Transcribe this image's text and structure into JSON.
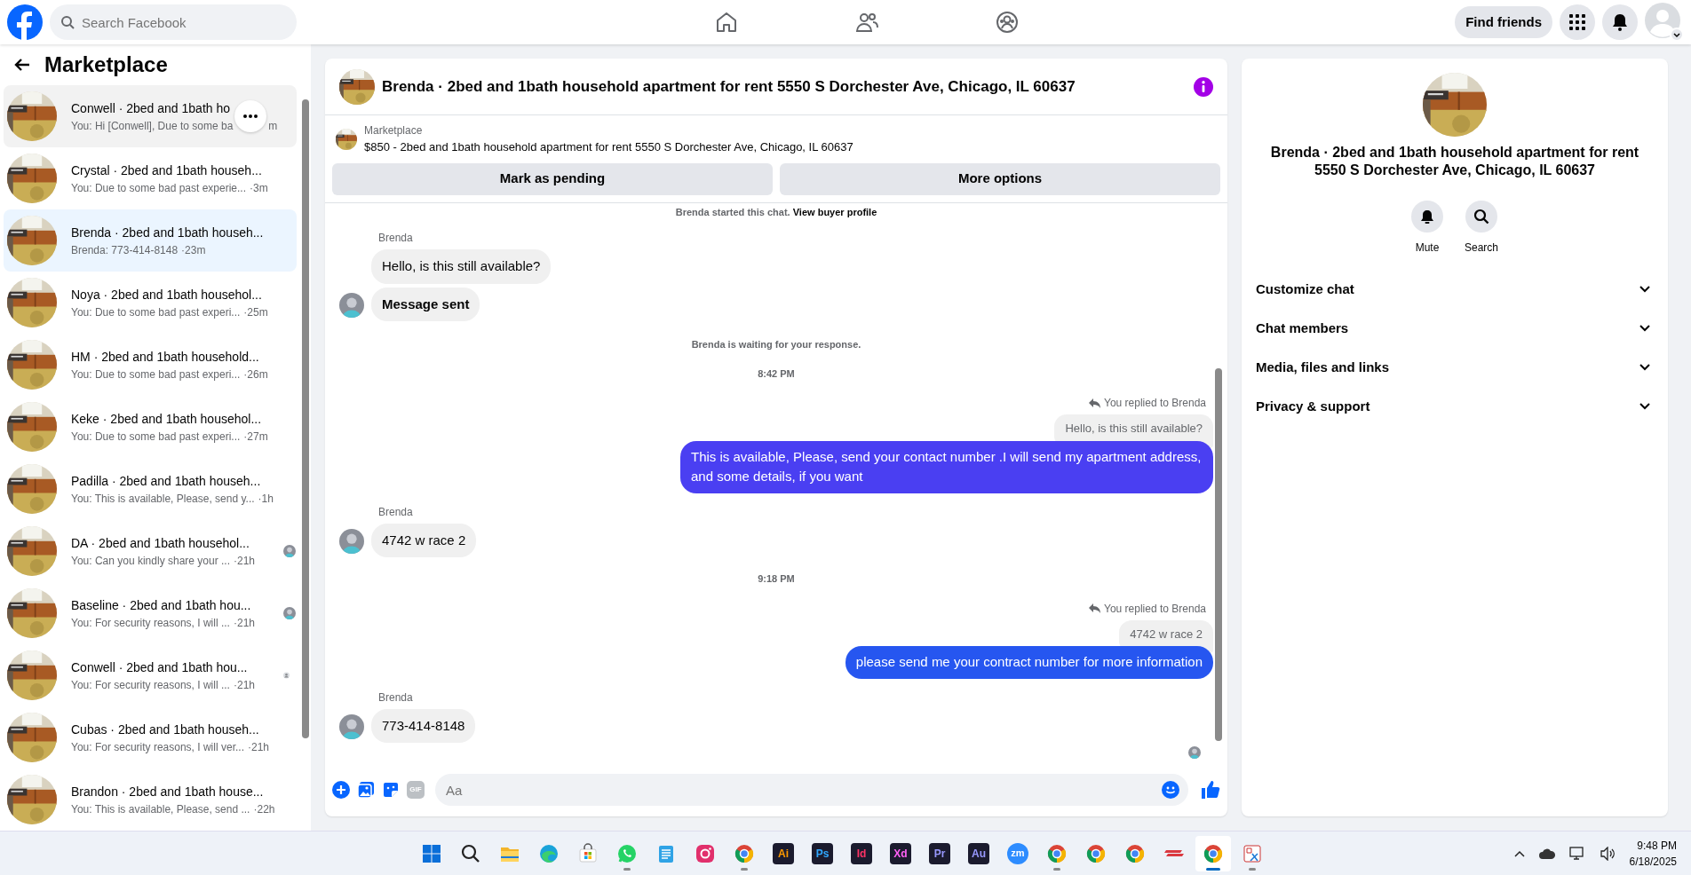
{
  "topbar": {
    "search": {
      "placeholder": "Search Facebook"
    },
    "nav": [
      {
        "kind": "home",
        "selected": false
      },
      {
        "kind": "friends",
        "selected": false
      },
      {
        "kind": "groups",
        "selected": false
      }
    ],
    "find_friends": "Find friends"
  },
  "sidebar": {
    "title": "Marketplace",
    "conversations": [
      {
        "title": "Conwell · 2bed and 1bath ho",
        "preview": "You: Hi [Conwell], Due to some ba",
        "time": "m",
        "selected": false,
        "hovered": true
      },
      {
        "title": "Crystal · 2bed and 1bath househ...",
        "preview": "You: Due to some bad past experie...",
        "time": "·3m",
        "selected": false,
        "hovered": false
      },
      {
        "title": "Brenda · 2bed and 1bath househ...",
        "preview": "Brenda: 773-414-8148",
        "time": "·23m",
        "selected": true,
        "hovered": false
      },
      {
        "title": "Noya · 2bed and 1bath househol...",
        "preview": "You: Due to some bad past experi...",
        "time": "·25m",
        "selected": false,
        "hovered": false
      },
      {
        "title": "HM · 2bed and 1bath household...",
        "preview": "You: Due to some bad past experi...",
        "time": "·26m",
        "selected": false,
        "hovered": false
      },
      {
        "title": "Keke · 2bed and 1bath househol...",
        "preview": "You: Due to some bad past experi...",
        "time": "·27m",
        "selected": false,
        "hovered": false
      },
      {
        "title": "Padilla · 2bed and 1bath househ...",
        "preview": "You: This is available, Please, send y...",
        "time": "·1h",
        "selected": false,
        "hovered": false
      },
      {
        "title": "DA · 2bed and 1bath househol...",
        "preview": "You: Can you kindly share your ...",
        "time": "·21h",
        "selected": false,
        "hovered": false
      },
      {
        "title": "Baseline · 2bed and 1bath hou...",
        "preview": "You: For security reasons, I will ...",
        "time": "·21h",
        "selected": false,
        "hovered": false
      },
      {
        "title": "Conwell · 2bed and 1bath hou...",
        "preview": "You: For security reasons, I will ...",
        "time": "·21h",
        "selected": false,
        "hovered": false,
        "receipt": {
          "kind": "silhouette"
        }
      },
      {
        "title": "Cubas · 2bed and 1bath househ...",
        "preview": "You: For security reasons, I will ver...",
        "time": "·21h",
        "selected": false,
        "hovered": false
      },
      {
        "title": "Brandon · 2bed and 1bath house...",
        "preview": "You: This is available, Please, send ...",
        "time": "·22h",
        "selected": false,
        "hovered": false
      }
    ]
  },
  "chat": {
    "title": "Brenda · 2bed and 1bath household apartment for rent 5550 S Dorchester Ave, Chicago, IL 60637",
    "listing": {
      "label": "Marketplace",
      "text": "$850 - 2bed and 1bath household apartment for rent 5550 S Dorchester Ave, Chicago, IL 60637",
      "buttons": [
        "Mark as pending",
        "More options"
      ]
    },
    "messages": [
      {
        "kind": "system",
        "text": "Brenda started this chat.",
        "link": "View buyer profile"
      },
      {
        "kind": "incoming",
        "sender": "Brenda",
        "bubbles": [
          {
            "text": "Hello, is this still available?",
            "bold": false
          },
          {
            "text": "Message sent",
            "bold": true
          }
        ]
      },
      {
        "kind": "status",
        "text": "Brenda is waiting for your response."
      },
      {
        "kind": "time",
        "text": "8:42 PM"
      },
      {
        "kind": "outgoing",
        "reply_note": "You replied to Brenda",
        "quoted": "Hello, is this still available?",
        "text": "This is  available, Please, send your contact number .I will send my apartment address, and some details, if you want",
        "color": "#4a3ff2"
      },
      {
        "kind": "incoming",
        "sender": "Brenda",
        "bubbles": [
          {
            "text": "4742 w race 2",
            "bold": false
          }
        ]
      },
      {
        "kind": "time",
        "text": "9:18 PM"
      },
      {
        "kind": "outgoing",
        "reply_note": "You replied to Brenda",
        "quoted": "4742 w race 2",
        "text": "please send me your contract number for more information",
        "color": "#2656f0"
      },
      {
        "kind": "incoming",
        "sender": "Brenda",
        "bubbles": [
          {
            "text": "773-414-8148",
            "bold": false
          }
        ]
      }
    ],
    "composer": {
      "gif": "GIF",
      "placeholder": "Aa"
    }
  },
  "details": {
    "title": "Brenda · 2bed and 1bath household apartment for rent 5550 S Dorchester Ave, Chicago, IL 60637",
    "actions": [
      {
        "kind": "mute",
        "label": "Mute"
      },
      {
        "kind": "search",
        "label": "Search"
      }
    ],
    "sections": [
      {
        "label": "Customize chat",
        "expanded": false
      },
      {
        "label": "Chat members",
        "expanded": false
      },
      {
        "label": "Media, files and links",
        "expanded": false
      },
      {
        "label": "Privacy & support",
        "expanded": false
      }
    ]
  },
  "taskbar": {
    "apps": [
      {
        "kind": "windows",
        "running": false,
        "active": false
      },
      {
        "kind": "search",
        "running": false,
        "active": false
      },
      {
        "kind": "folder",
        "running": false,
        "active": false
      },
      {
        "kind": "edge",
        "running": false,
        "active": false
      },
      {
        "kind": "store",
        "running": false,
        "active": false
      },
      {
        "kind": "whatsapp",
        "running": true,
        "active": false
      },
      {
        "kind": "notepad",
        "running": false,
        "active": false
      },
      {
        "kind": "instagram",
        "running": false,
        "active": false
      },
      {
        "kind": "chrome",
        "running": true,
        "active": false
      },
      {
        "kind": "label",
        "text": "Ai",
        "color": "#ff9a00",
        "running": false,
        "active": false
      },
      {
        "kind": "label",
        "text": "Ps",
        "color": "#31a8ff",
        "running": false,
        "active": false
      },
      {
        "kind": "label",
        "text": "Id",
        "color": "#ff3366",
        "running": false,
        "active": false
      },
      {
        "kind": "label",
        "text": "Xd",
        "color": "#ff61f6",
        "running": false,
        "active": false
      },
      {
        "kind": "label",
        "text": "Pr",
        "color": "#9999ff",
        "running": false,
        "active": false
      },
      {
        "kind": "label",
        "text": "Au",
        "color": "#9999ff",
        "running": false,
        "active": false
      },
      {
        "kind": "zoom",
        "text": "zm",
        "running": false,
        "active": false
      },
      {
        "kind": "chrome",
        "running": true,
        "active": false
      },
      {
        "kind": "chrome",
        "running": false,
        "active": false
      },
      {
        "kind": "chrome",
        "running": false,
        "active": false
      },
      {
        "kind": "vpn",
        "running": false,
        "active": false
      },
      {
        "kind": "chrome",
        "running": true,
        "active": true
      },
      {
        "kind": "snip",
        "running": true,
        "active": false
      }
    ],
    "time": "9:48 PM",
    "date": "6/18/2025"
  }
}
